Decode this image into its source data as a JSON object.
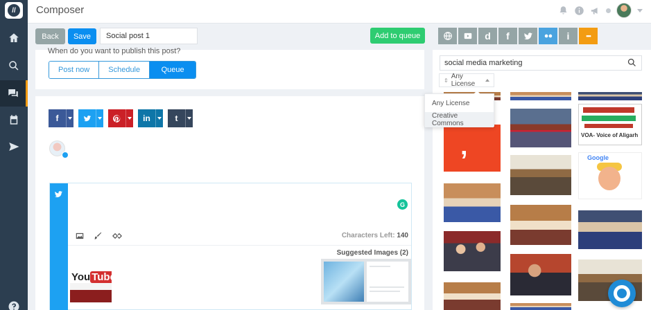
{
  "app": {
    "title": "Composer"
  },
  "toolbar": {
    "back_label": "Back",
    "save_label": "Save",
    "post_title_value": "Social post 1",
    "add_to_queue_label": "Add to queue"
  },
  "sources": [
    {
      "name": "globe-icon"
    },
    {
      "name": "youtube-icon"
    },
    {
      "name": "dailymotion-icon",
      "glyph": "d"
    },
    {
      "name": "facebook-icon",
      "glyph": "f"
    },
    {
      "name": "twitter-icon"
    },
    {
      "name": "flickr-icon",
      "active": true
    },
    {
      "name": "info-icon",
      "glyph": "i"
    },
    {
      "name": "more-icon",
      "glyph": "•••"
    }
  ],
  "schedule": {
    "question": "When do you want to publish this post?",
    "options": [
      "Post now",
      "Schedule",
      "Queue"
    ],
    "selected": "Queue"
  },
  "networks": [
    {
      "name": "facebook",
      "glyph": "f"
    },
    {
      "name": "twitter",
      "glyph": "t"
    },
    {
      "name": "pinterest",
      "glyph": "p"
    },
    {
      "name": "linkedin",
      "glyph": "in"
    },
    {
      "name": "tumblr",
      "glyph": "t"
    }
  ],
  "tweet": {
    "grammarly_glyph": "G",
    "characters_left_label": "Characters Left:",
    "characters_left_value": "140",
    "suggested_images_label": "Suggested Images (2)",
    "yt_you": "You",
    "yt_tube": "Tube"
  },
  "image_search": {
    "query": "social media marketing",
    "license_selected": "Any License",
    "license_options": [
      "Any License",
      "Creative Commons"
    ],
    "hindi_caption": "VOA- Voice of Aligarh"
  },
  "colors": {
    "accent": "#0a8ef0",
    "success": "#2ecc71",
    "sidebar": "#2c3e50",
    "source_more": "#f39c12",
    "twitter": "#1da1f2"
  }
}
